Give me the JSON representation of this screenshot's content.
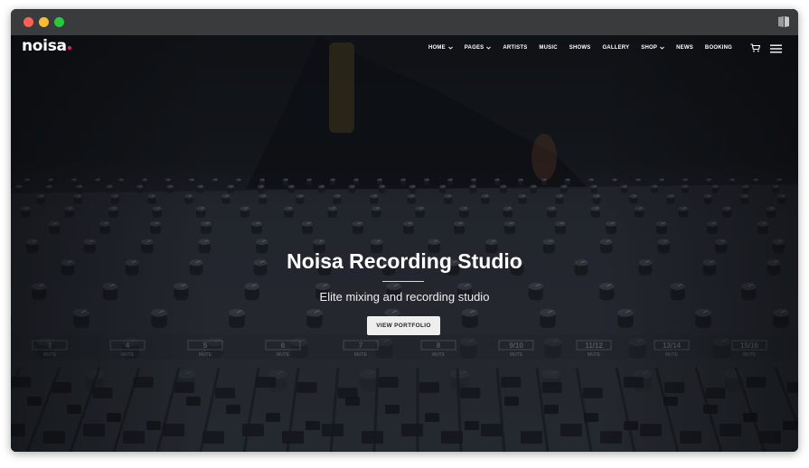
{
  "window": {
    "controls": [
      "close",
      "minimize",
      "maximize"
    ]
  },
  "navbar": {
    "logo_text": "noisa",
    "logo_accent_color": "#e0245e",
    "menu": [
      {
        "label": "HOME",
        "has_dropdown": true
      },
      {
        "label": "PAGES",
        "has_dropdown": true
      },
      {
        "label": "ARTISTS",
        "has_dropdown": false
      },
      {
        "label": "MUSIC",
        "has_dropdown": false
      },
      {
        "label": "SHOWS",
        "has_dropdown": false
      },
      {
        "label": "GALLERY",
        "has_dropdown": false
      },
      {
        "label": "SHOP",
        "has_dropdown": true
      },
      {
        "label": "NEWS",
        "has_dropdown": false
      },
      {
        "label": "BOOKING",
        "has_dropdown": false
      }
    ],
    "icons": [
      "cart-icon",
      "hamburger-menu-icon"
    ]
  },
  "hero": {
    "background": "mixing-console-photo",
    "title": "Noisa Recording Studio",
    "subtitle": "Elite mixing and recording studio",
    "button_label": "VIEW PORTFOLIO"
  },
  "mixer": {
    "channel_labels": [
      "3",
      "4",
      "5",
      "6",
      "7",
      "8",
      "9/10",
      "11/12",
      "13/14",
      "15/16"
    ],
    "mute_label": "MUTE"
  }
}
